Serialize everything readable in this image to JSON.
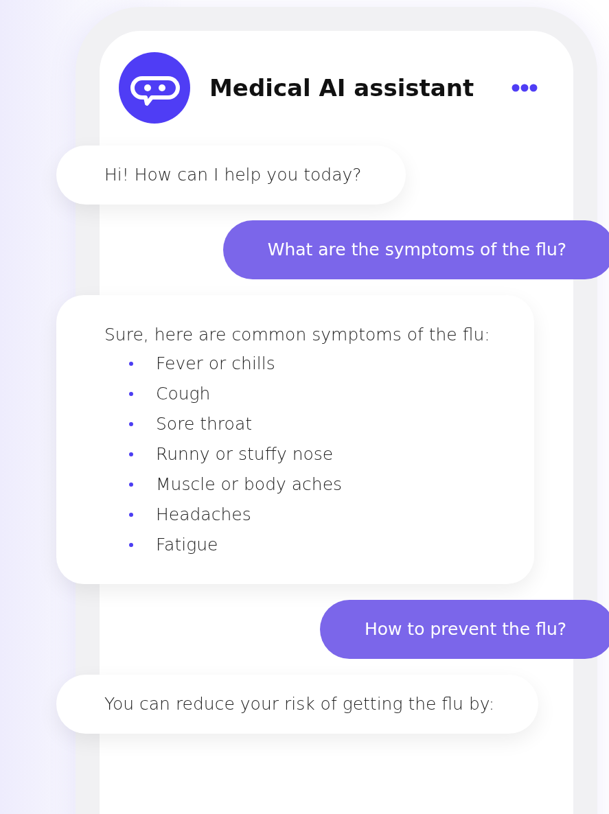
{
  "header": {
    "title": "Medical AI assistant"
  },
  "messages": [
    {
      "kind": "bot",
      "text": "Hi! How can I help you today?"
    },
    {
      "kind": "user",
      "text": "What are the symptoms of the flu?"
    },
    {
      "kind": "bot",
      "text": "Sure, here are common symptoms of the flu:",
      "bullets": [
        "Fever or chills",
        "Cough",
        "Sore throat",
        "Runny or stuffy nose",
        "Muscle or body aches",
        "Headaches",
        "Fatigue"
      ]
    },
    {
      "kind": "user",
      "text": "How to prevent the flu?"
    },
    {
      "kind": "bot",
      "text": "You can reduce your risk of getting the flu by:"
    }
  ]
}
